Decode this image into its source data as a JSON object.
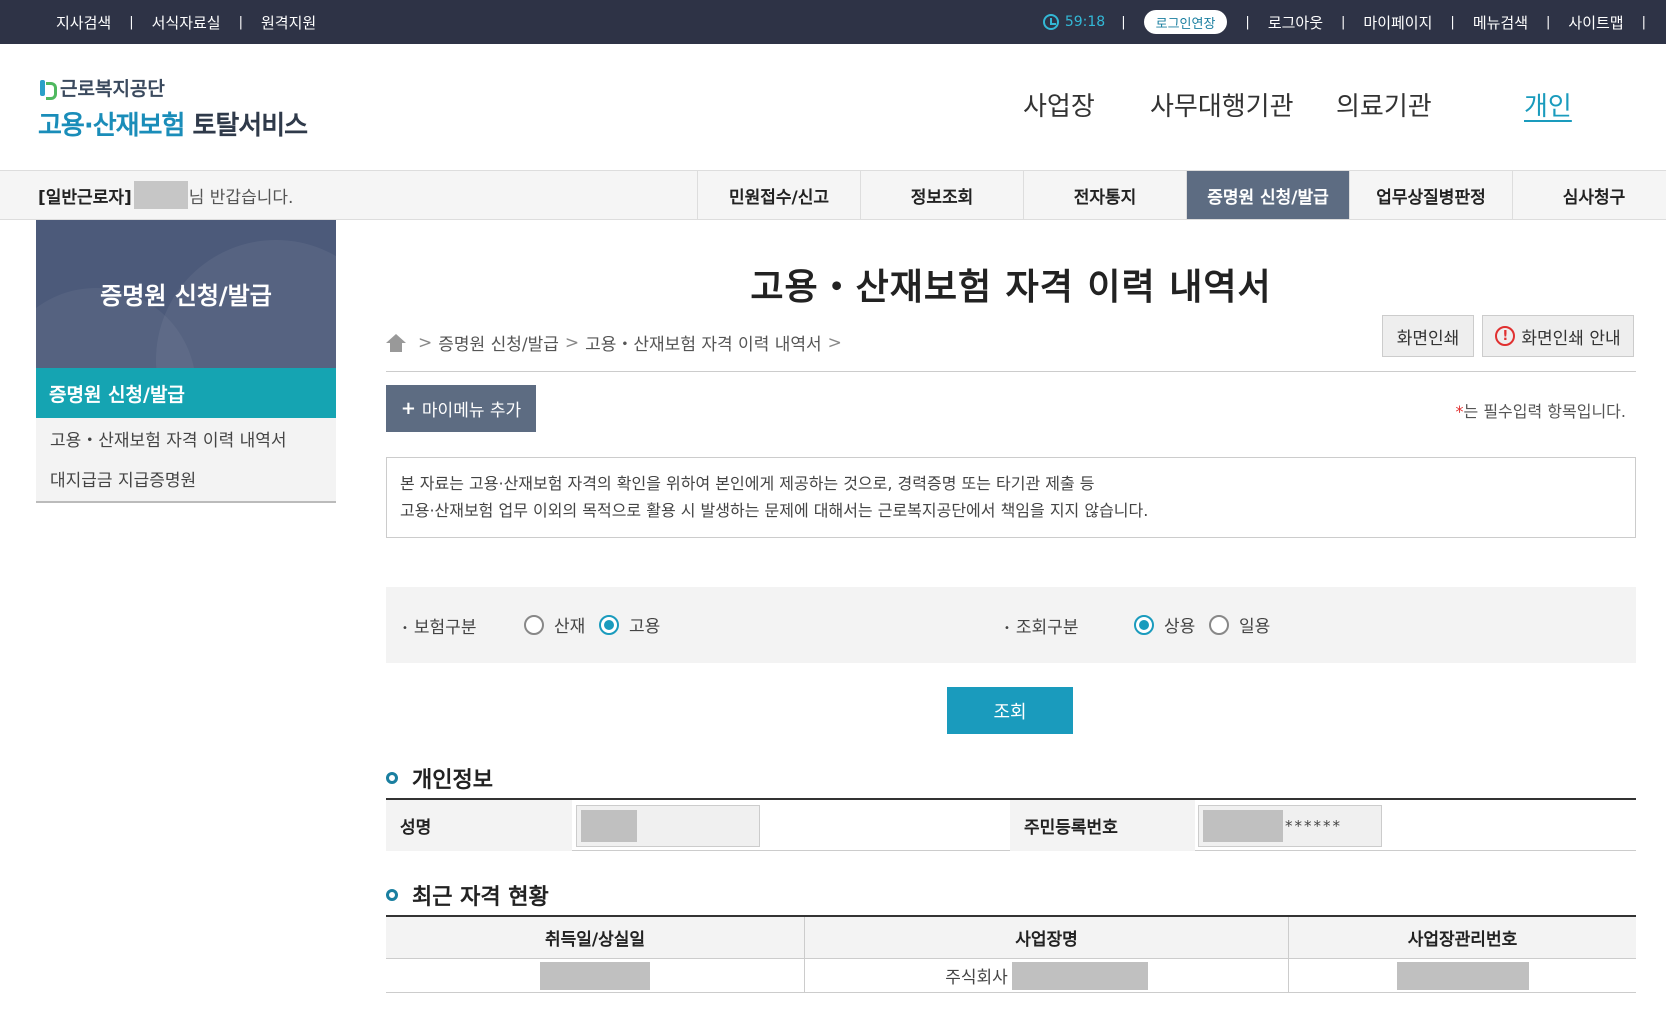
{
  "topbar": {
    "links": [
      "지사검색",
      "서식자료실",
      "원격지원"
    ],
    "timer": "59:18",
    "extend_login": "로그인연장",
    "user_links": [
      "로그아웃",
      "마이페이지",
      "메뉴검색",
      "사이트맵"
    ],
    "separator": "|"
  },
  "logo": {
    "org": "근로복지공단",
    "service_part1": "고용·산재보험",
    "service_part2": "토탈서비스"
  },
  "main_nav": {
    "items": [
      "사업장",
      "사무대행기관",
      "의료기관",
      "개인"
    ],
    "active": "개인"
  },
  "greeting": {
    "role": "[일반근로자]",
    "suffix": "님 반갑습니다."
  },
  "tabs": {
    "items": [
      "민원접수/신고",
      "정보조회",
      "전자통지",
      "증명원 신청/발급",
      "업무상질병판정",
      "심사청구"
    ],
    "active": "증명원 신청/발급"
  },
  "sidebar": {
    "title": "증명원 신청/발급",
    "active_section": "증명원 신청/발급",
    "items": [
      "고용・산재보험 자격 이력 내역서",
      "대지급금 지급증명원"
    ]
  },
  "content": {
    "page_title": "고용・산재보험 자격 이력 내역서",
    "breadcrumb": [
      "증명원 신청/발급",
      "고용・산재보험 자격 이력 내역서"
    ],
    "print_button": "화면인쇄",
    "print_guide_button": "화면인쇄 안내",
    "mymenu_button": "마이메뉴 추가",
    "required_note_star": "*",
    "required_note": "는 필수입력 항목입니다.",
    "notice_line1": "본 자료는 고용·산재보험 자격의 확인을 위하여 본인에게 제공하는 것으로, 경력증명 또는 타기관 제출 등",
    "notice_line2": "고용·산재보험 업무 이외의 목적으로 활용 시 발생하는 문제에 대해서는 근로복지공단에서 책임을 지지 않습니다."
  },
  "search": {
    "insurance_label": "보험구분",
    "insurance_options": [
      "산재",
      "고용"
    ],
    "insurance_selected": "고용",
    "query_label": "조회구분",
    "query_options": [
      "상용",
      "일용"
    ],
    "query_selected": "상용",
    "submit": "조회"
  },
  "personal_info": {
    "section_title": "개인정보",
    "name_label": "성명",
    "rrn_label": "주민등록번호",
    "rrn_suffix": "******"
  },
  "recent_status": {
    "section_title": "최근 자격 현황",
    "columns": [
      "취득일/상실일",
      "사업장명",
      "사업장관리번호"
    ],
    "row": {
      "company_prefix": "주식회사"
    }
  },
  "colors": {
    "topbar_bg": "#2e3346",
    "accent": "#1a9bbd",
    "tab_active_bg": "#5d6c82",
    "sidebar_head_bg": "#4c5a7a",
    "sidebar_active_bg": "#15a4b2"
  }
}
